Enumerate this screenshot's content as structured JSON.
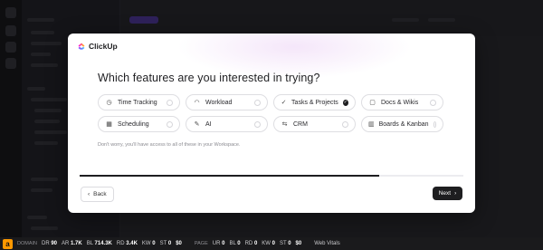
{
  "brand": {
    "name": "ClickUp"
  },
  "onboarding": {
    "heading": "Which features are you interested in trying?",
    "options": [
      {
        "label": "Time Tracking",
        "icon": "clock-icon",
        "glyph": "◷",
        "selected": false
      },
      {
        "label": "Workload",
        "icon": "gauge-icon",
        "glyph": "◠",
        "selected": false
      },
      {
        "label": "Tasks & Projects",
        "icon": "check-circle-icon",
        "glyph": "✓",
        "selected": true
      },
      {
        "label": "Docs & Wikis",
        "icon": "doc-icon",
        "glyph": "▢",
        "selected": false
      },
      {
        "label": "Scheduling",
        "icon": "calendar-icon",
        "glyph": "▦",
        "selected": false
      },
      {
        "label": "AI",
        "icon": "magic-wand-icon",
        "glyph": "✎",
        "selected": false
      },
      {
        "label": "CRM",
        "icon": "crm-icon",
        "glyph": "⇆",
        "selected": false
      },
      {
        "label": "Boards & Kanban",
        "icon": "kanban-icon",
        "glyph": "▥",
        "selected": false
      }
    ],
    "note": "Don't worry, you'll have access to all of these in your Workspace.",
    "progress": 0.78,
    "back_label": "Back",
    "next_label": "Next"
  },
  "seo_toolbar": {
    "logo": "a",
    "domain_label": "DOMAIN",
    "domain_metrics": [
      {
        "key": "DR",
        "value": "90"
      },
      {
        "key": "AR",
        "value": "1.7K"
      },
      {
        "key": "BL",
        "value": "714.3K"
      },
      {
        "key": "RD",
        "value": "3.4K"
      },
      {
        "key": "KW",
        "value": "0"
      },
      {
        "key": "ST",
        "value": "0"
      },
      {
        "key": "",
        "value": "$0"
      }
    ],
    "page_label": "PAGE",
    "page_metrics": [
      {
        "key": "UR",
        "value": "0"
      },
      {
        "key": "BL",
        "value": "0"
      },
      {
        "key": "RD",
        "value": "0"
      },
      {
        "key": "KW",
        "value": "0"
      },
      {
        "key": "ST",
        "value": "0"
      },
      {
        "key": "",
        "value": "$0"
      }
    ],
    "vitals_label": "Web Vitals"
  },
  "colors": {
    "primary": "#1e1e20",
    "border": "#dedee2",
    "background_app": "#2a2a2c"
  }
}
